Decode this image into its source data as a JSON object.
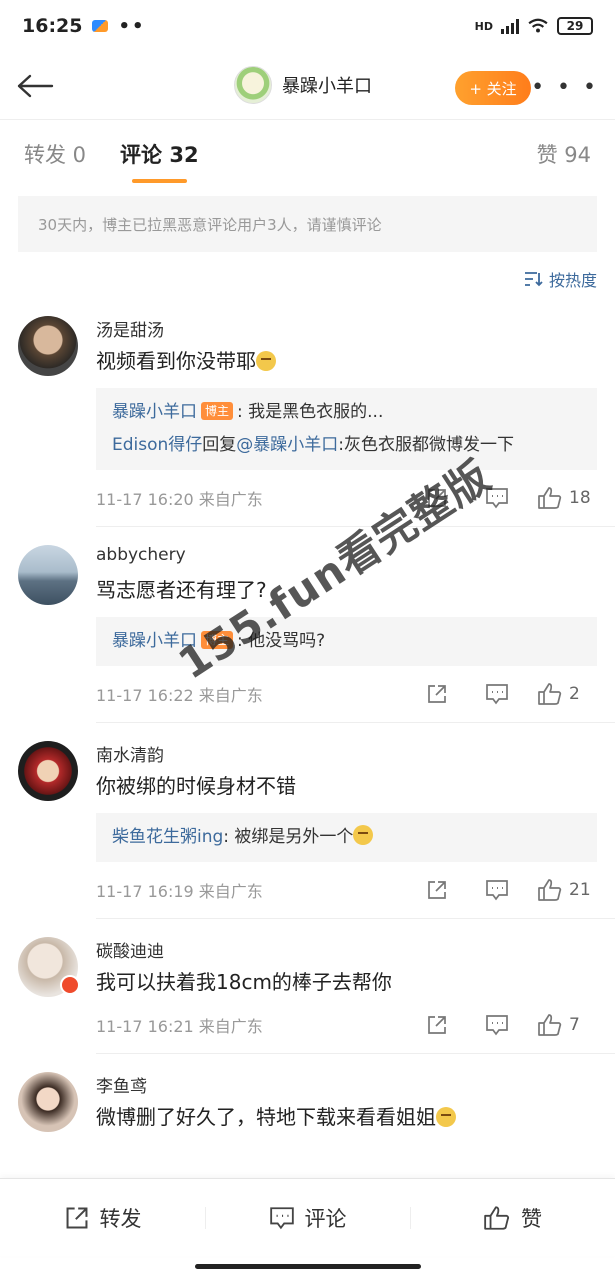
{
  "status_bar": {
    "time": "16:25",
    "network": "HD",
    "battery": "29"
  },
  "nav": {
    "title": "暴躁小羊口",
    "follow_label": "+ 关注",
    "more": "• • •"
  },
  "tabs": [
    {
      "label": "转发 0"
    },
    {
      "label": "评论 32"
    },
    {
      "label": "赞 94"
    }
  ],
  "notice": "30天内，博主已拉黑恶意评论用户3人，请谨慎评论",
  "sort_label": "按热度",
  "comments": [
    {
      "name": "汤是甜汤",
      "text": "视频看到你没带耶",
      "replies": [
        {
          "name": "暴躁小羊口",
          "tag": "博主",
          "text": ": 我是黑色衣服的..."
        },
        {
          "name": "Edison得仔",
          "text": "回复",
          "mention": "@暴躁小羊口",
          "text2": ":灰色衣服都微博发一下"
        }
      ],
      "time": "11-17 16:20  来自广东",
      "likes": "18"
    },
    {
      "name": "abbychery",
      "text": "骂志愿者还有理了?",
      "replies": [
        {
          "name": "暴躁小羊口",
          "tag": "博主",
          "text": ": 他没骂吗?"
        }
      ],
      "time": "11-17 16:22  来自广东",
      "likes": "2"
    },
    {
      "name": "南水清韵",
      "text": "你被绑的时候身材不错",
      "replies": [
        {
          "name": "柴鱼花生粥ing",
          "text": ": 被绑是另外一个"
        }
      ],
      "time": "11-17 16:19  来自广东",
      "likes": "21"
    },
    {
      "name": "碳酸迪迪",
      "text": "我可以扶着我18cm的棒子去帮你",
      "time": "11-17 16:21  来自广东",
      "likes": "7"
    },
    {
      "name": "李鱼鸢",
      "text": "微博删了好久了，特地下载来看看姐姐"
    }
  ],
  "watermark": "155.fun看完整版",
  "bottom_bar": {
    "repost": "转发",
    "comment": "评论",
    "like": "赞"
  }
}
